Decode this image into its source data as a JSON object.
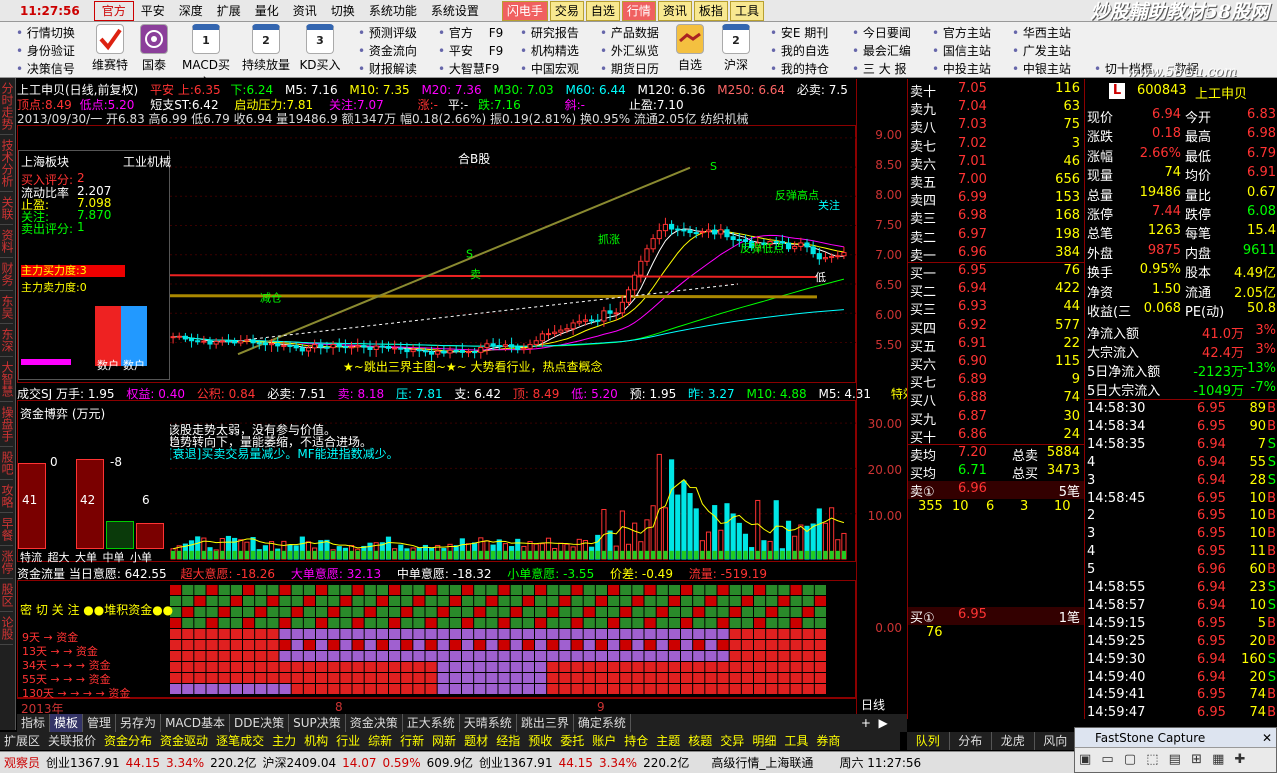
{
  "menubar": {
    "items": [
      "官方",
      "平安",
      "深度",
      "扩展",
      "量化",
      "资讯",
      "切换",
      "系统功能",
      "系统设置"
    ],
    "clock": "11:27:56",
    "right_buttons": [
      "闪电手",
      "交易",
      "自选",
      "行情",
      "资讯",
      "板指",
      "工具"
    ],
    "watermark": "炒股輔助教材58股网",
    "watermark_url": "www.58Gu.com"
  },
  "toolbar": {
    "col1": [
      "行情切换",
      "身份验证",
      "决策信号"
    ],
    "big": [
      {
        "label": "维赛特",
        "icon": "check-icon"
      },
      {
        "label": "国泰",
        "icon": "tv-icon"
      },
      {
        "label": "MACD买入",
        "icon": "calendar-1-icon",
        "num": "1"
      },
      {
        "label": "持续放量",
        "icon": "calendar-2-icon",
        "num": "2"
      },
      {
        "label": "KD买入",
        "icon": "calendar-3-icon",
        "num": "3"
      }
    ],
    "col2": [
      "预测评级",
      "资金流向",
      "财报解读"
    ],
    "col3": [
      "官方　 F9",
      "平安　 F9",
      "大智慧F9"
    ],
    "col4": [
      "研究报告",
      "机构精选",
      "中国宏观"
    ],
    "col5": [
      "产品数据",
      "外汇纵览",
      "期货日历"
    ],
    "big2": [
      {
        "label": "自选",
        "icon": "handshake-icon"
      },
      {
        "label": "沪深",
        "icon": "calendar-2b-icon",
        "num": "2"
      }
    ],
    "col6": [
      "安E 期刊",
      "我的自选",
      "我的持仓"
    ],
    "col7": [
      "今日要闻",
      "最会汇编",
      "三 大 报"
    ],
    "col8": [
      "官方主站",
      "国信主站",
      "中投主站"
    ],
    "col9": [
      "华西主站",
      "广发主站",
      "中银主站"
    ],
    "col10": [
      "切十档框",
      "数据"
    ]
  },
  "lefttabs": [
    "分时走势",
    "技术分析",
    "关联",
    "资料",
    "财务",
    "东吴",
    "东深",
    "大智慧",
    "操盘手",
    "股吧",
    "攻略",
    "早餐",
    "涨停",
    "股区",
    "论股"
  ],
  "chart": {
    "title_row": {
      "name": "上工申贝(日线,前复权)",
      "a1": "平安 上:6.35",
      "a2": "下:6.24",
      "m5": "M5: 7.16",
      "m10": "M10: 7.35",
      "m20": "M20: 7.36",
      "m30": "M30: 7.03",
      "m60": "M60: 6.44",
      "m120": "M120: 6.36",
      "m250": "M250: 6.64",
      "bx": "必卖: 7.5"
    },
    "row2": {
      "a": "顶点:8.49",
      "b": "低点:5.20",
      "c": "短支ST:6.42",
      "d": "启动压力:7.81",
      "e": "关注:7.07",
      "f": "涨:-",
      "g": "平:-",
      "h": "跌:7.16",
      "i": "斜:-",
      "j": "止盈:7.10"
    },
    "row3": "2013/09/30/一 开6.83 高6.99 低6.79 收6.94 量19486.9 额1347万 幅0.18(2.66%) 振0.19(2.81%) 换0.95% 流通2.05亿 纺织机械",
    "kline_center_label": "合B股",
    "annotations": {
      "sell": "卖",
      "top_note": "S",
      "buy_s": "S",
      "stop": "止损",
      "a1": "反弹高点",
      "a2": "关注",
      "a3": "反弹低点",
      "a4": "减仓",
      "a5": "抓涨",
      "a6": "低"
    },
    "bottom_text": "★~跳出三界主图~★~ 大势看行业，热点查概念",
    "info_panel": {
      "title": "上海板块",
      "subtitle": "工业机械",
      "rows": [
        [
          "买入评分:",
          "2"
        ],
        [
          "流动比率",
          "2.207"
        ],
        [
          "止盈:",
          "7.098"
        ],
        [
          "关注:",
          "7.870"
        ],
        [
          "卖出评分:",
          "1"
        ]
      ],
      "bar1": "主力买力度:3",
      "bar2": "主力卖力度:0",
      "b1": "数户",
      "b2": "数户"
    },
    "kline_yaxis": [
      "9.00",
      "8.50",
      "8.00",
      "7.50",
      "7.00",
      "6.50",
      "6.00",
      "5.50"
    ],
    "kline_ylim": [
      5.2,
      9.1
    ],
    "panel2_head": {
      "a": "成交SJ 万手: 1.95",
      "b": "权益: 0.40",
      "c": "公积: 0.84",
      "d": "必卖: 7.51",
      "e": "卖: 8.18",
      "f": "压: 7.81",
      "g": "支: 6.42",
      "h": "顶: 8.49",
      "i": "低: 5.20",
      "j": "预: 1.95",
      "k": "昨: 3.27",
      "l": "M10: 4.88",
      "m": "M5: 4.31",
      "n": "特效"
    },
    "panel2_notes": [
      "该股走势太弱，没有参与价值。",
      "趋势转向下，量能萎缩，不适合进场。",
      "[衰退]买卖交易量减少。MF能进指数减少。"
    ],
    "panel2_yaxis": [
      "30.00",
      "20.00",
      "10.00"
    ],
    "fund_panel": {
      "title": "资金博弈 (万元)",
      "vals": [
        "0",
        "-8",
        "41",
        "42",
        "6"
      ],
      "labels": [
        "特流",
        "超大",
        "大单",
        "中单",
        "小单"
      ]
    },
    "panel3_head": {
      "a": "资金流量 当日意愿: 642.55",
      "b": "超大意愿: -18.26",
      "c": "大单意愿: 32.13",
      "d": "中单意愿: -18.32",
      "e": "小单意愿: -3.55",
      "f": "价差: -0.49",
      "g": "流量: -519.19"
    },
    "panel3_left": {
      "title": "密 切 关 注 ●●堆积资金●●",
      "rows": [
        "9天 → 资金",
        "13天 → → 资金",
        "34天 → → → 资金",
        "55天 → → → 资金",
        "130天 → → → → 资金"
      ]
    },
    "panel3_yaxis": [
      "0.00"
    ],
    "xaxis": {
      "year": "2013年",
      "m8": "8",
      "m9": "9"
    },
    "line_label": "日线"
  },
  "orderbook": {
    "sells": [
      [
        "卖十",
        "7.05",
        "116"
      ],
      [
        "卖九",
        "7.04",
        "63"
      ],
      [
        "卖八",
        "7.03",
        "75"
      ],
      [
        "卖七",
        "7.02",
        "3"
      ],
      [
        "卖六",
        "7.01",
        "46"
      ],
      [
        "卖五",
        "7.00",
        "656"
      ],
      [
        "卖四",
        "6.99",
        "153"
      ],
      [
        "卖三",
        "6.98",
        "168"
      ],
      [
        "卖二",
        "6.97",
        "198"
      ],
      [
        "卖一",
        "6.96",
        "384"
      ]
    ],
    "buys": [
      [
        "买一",
        "6.95",
        "76"
      ],
      [
        "买二",
        "6.94",
        "422"
      ],
      [
        "买三",
        "6.93",
        "44"
      ],
      [
        "买四",
        "6.92",
        "577"
      ],
      [
        "买五",
        "6.91",
        "22"
      ],
      [
        "买六",
        "6.90",
        "115"
      ],
      [
        "买七",
        "6.89",
        "9"
      ],
      [
        "买八",
        "6.88",
        "74"
      ],
      [
        "买九",
        "6.87",
        "30"
      ],
      [
        "买十",
        "6.86",
        "24"
      ]
    ],
    "avg_sell": [
      "卖均",
      "7.20",
      "总卖",
      "5884"
    ],
    "avg_buy": [
      "买均",
      "6.71",
      "总买",
      "3473"
    ],
    "sell1_queue": {
      "label": "卖①",
      "price": "6.96",
      "count": "5笔",
      "items": [
        "355",
        "10",
        "6",
        "3",
        "10"
      ]
    },
    "buy1_queue": {
      "label": "买①",
      "price": "6.95",
      "count": "1笔",
      "items": [
        "76"
      ]
    }
  },
  "quote": {
    "code": "600843",
    "name": "上工申贝",
    "rows": [
      [
        "现价",
        "6.94",
        "今开",
        "6.83"
      ],
      [
        "涨跌",
        "0.18",
        "最高",
        "6.98"
      ],
      [
        "涨幅",
        "2.66%",
        "最低",
        "6.79"
      ],
      [
        "现量",
        "74",
        "均价",
        "6.91"
      ],
      [
        "总量",
        "19486",
        "量比",
        "0.67"
      ],
      [
        "涨停",
        "7.44",
        "跌停",
        "6.08"
      ],
      [
        "总笔",
        "1263",
        "每笔",
        "15.4"
      ],
      [
        "外盘",
        "9875",
        "内盘",
        "9611"
      ],
      [
        "换手",
        "0.95%",
        "股本",
        "4.49亿"
      ],
      [
        "净资",
        "1.50",
        "流通",
        "2.05亿"
      ],
      [
        "收益(三",
        "0.068",
        "PE(动)",
        "50.8"
      ]
    ],
    "flows": [
      [
        "净流入额",
        "41.0万",
        "3%"
      ],
      [
        "大宗流入",
        "42.4万",
        "3%"
      ],
      [
        "5日净流入额",
        "-2123万",
        "-13%"
      ],
      [
        "5日大宗流入",
        "-1049万",
        "-7%"
      ]
    ],
    "ticks": [
      [
        "14:58:30",
        "6.95",
        "89",
        "B"
      ],
      [
        "14:58:34",
        "6.95",
        "90",
        "B"
      ],
      [
        "14:58:35",
        "6.94",
        "7",
        "S"
      ],
      [
        "4",
        "6.94",
        "55",
        "S"
      ],
      [
        "3",
        "6.94",
        "28",
        "S"
      ],
      [
        "14:58:45",
        "6.95",
        "10",
        "B"
      ],
      [
        "2",
        "6.95",
        "10",
        "B"
      ],
      [
        "3",
        "6.95",
        "10",
        "B"
      ],
      [
        "4",
        "6.95",
        "11",
        "B"
      ],
      [
        "5",
        "6.96",
        "60",
        "B"
      ],
      [
        "14:58:55",
        "6.94",
        "23",
        "S"
      ],
      [
        "14:58:57",
        "6.94",
        "10",
        "S"
      ],
      [
        "14:59:15",
        "6.95",
        "5",
        "B"
      ],
      [
        "14:59:25",
        "6.95",
        "20",
        "B"
      ],
      [
        "14:59:30",
        "6.94",
        "160",
        "S"
      ],
      [
        "14:59:40",
        "6.94",
        "20",
        "S"
      ],
      [
        "14:59:41",
        "6.95",
        "74",
        "B"
      ],
      [
        "14:59:47",
        "6.95",
        "74",
        "B"
      ]
    ]
  },
  "bottomtabs": [
    "指标",
    "模板",
    "管理",
    "另存为",
    "MACD基本",
    "DDE决策",
    "SUP决策",
    "资金决策",
    "正大系统",
    "天晴系统",
    "跳出三界",
    "确定系统"
  ],
  "bottomtabs2": [
    "扩展区",
    "关联报价",
    "资金分布",
    "资金驱动",
    "逐笔成交",
    "主力",
    "机构",
    "行业",
    "综新",
    "行新",
    "网新",
    "题材",
    "经指",
    "预收",
    "委托",
    "账户",
    "持仓",
    "主题",
    "核题",
    "交异",
    "明细",
    "工具",
    "券商"
  ],
  "rtabs": [
    "队列",
    "分布",
    "龙虎",
    "风向"
  ],
  "status": {
    "a": "观察员",
    "b": "创业1367.91",
    "c": "44.15",
    "d": "3.34%",
    "e": "220.2亿",
    "f": "沪深2409.04",
    "g": "14.07",
    "h": "0.59%",
    "i": "609.9亿",
    "j": "创业1367.91",
    "k": "44.15",
    "l": "3.34%",
    "m": "220.2亿",
    "n": "高级行情_上海联通",
    "o": "周六 11:27:56"
  },
  "capture": {
    "title": "FastStone Capture"
  },
  "colors": {
    "up": "#ff3232",
    "down": "#00e6e6",
    "yellow": "#ffff00",
    "bg": "#000000",
    "grid": "#8b0000"
  }
}
